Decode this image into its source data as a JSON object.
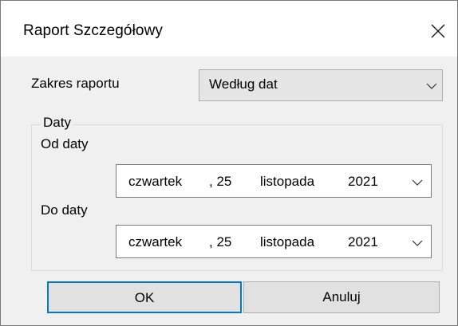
{
  "window": {
    "title": "Raport Szczegółowy",
    "close_icon": "close-icon"
  },
  "report_range": {
    "label": "Zakres raportu",
    "selected": "Według dat"
  },
  "dates_group": {
    "legend": "Daty",
    "from": {
      "label": "Od daty",
      "weekday": "czwartek",
      "day": ", 25",
      "month": "listopada",
      "year": "2021"
    },
    "to": {
      "label": "Do daty",
      "weekday": "czwartek",
      "day": ", 25",
      "month": "listopada",
      "year": "2021"
    }
  },
  "buttons": {
    "ok_label": "OK",
    "cancel_label": "Anuluj"
  },
  "colors": {
    "accent": "#0078d7",
    "dialog_bg": "#f0f0f0",
    "title_bg": "#ffffff"
  }
}
